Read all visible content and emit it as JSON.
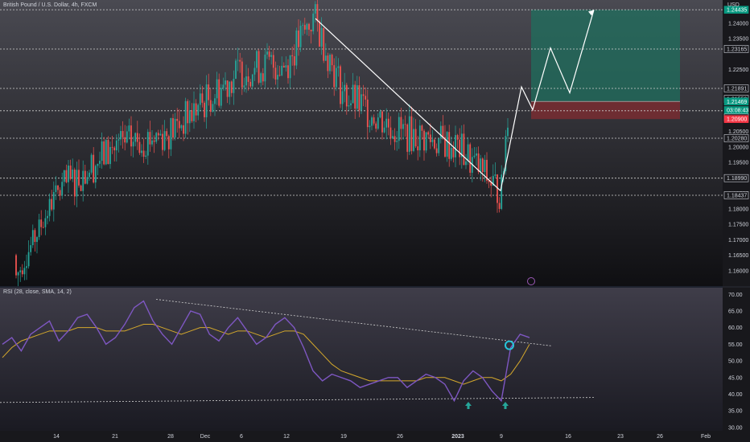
{
  "header": {
    "title": "British Pound / U.S. Dollar, 4h, FXCM",
    "currency": "USD"
  },
  "rsi_header": {
    "title": "RSI (28, close, SMA, 14, 2)"
  },
  "colors": {
    "up": "#26a69a",
    "down": "#ef5350",
    "rsi": "#7e57c2",
    "sma": "#d4a82c",
    "tp_zone": "#1f6f5e",
    "sl_zone": "#7d2c31"
  },
  "chart_data": [
    {
      "type": "candlestick",
      "title": "British Pound / U.S. Dollar, 4h, FXCM",
      "ylim": [
        1.155,
        1.2475
      ],
      "price_ticks": [
        "1.24000",
        "1.23500",
        "1.22500",
        "1.20500",
        "1.20000",
        "1.19500",
        "1.18500",
        "1.18000",
        "1.17500",
        "1.17000",
        "1.16500",
        "1.16000"
      ],
      "x_ticks": [
        "14",
        "21",
        "28",
        "Dec",
        "6",
        "12",
        "19",
        "26",
        "2023",
        "9",
        "16",
        "23",
        "26",
        "Feb"
      ],
      "horizontal_levels": [
        "1.24435",
        "1.23165",
        "1.21891",
        "1.21169",
        "1.20280",
        "1.18990",
        "1.18437"
      ],
      "price_labels": [
        {
          "text": "1.24435",
          "value": 1.24435,
          "style": "green"
        },
        {
          "text": "1.23165",
          "value": 1.23165,
          "style": "outline"
        },
        {
          "text": "1.21891",
          "value": 1.21891,
          "style": "outline"
        },
        {
          "text": "1.21550",
          "value": 1.2155,
          "style": "outline"
        },
        {
          "text": "1.21469",
          "value": 1.21469,
          "style": "green"
        },
        {
          "text": "03:08:43",
          "value": 1.2119,
          "style": "green"
        },
        {
          "text": "1.21117",
          "value": 1.20947,
          "style": "outline"
        },
        {
          "text": "1.20900",
          "value": 1.209,
          "style": "red"
        },
        {
          "text": "1.20280",
          "value": 1.2028,
          "style": "outline"
        },
        {
          "text": "1.18990",
          "value": 1.1899,
          "style": "outline"
        },
        {
          "text": "1.18437",
          "value": 1.18437,
          "style": "outline"
        }
      ],
      "trade_box": {
        "entry": 1.21469,
        "target": 1.24435,
        "stop": 1.209
      },
      "price_path": [
        {
          "label": "Nov 14",
          "close": 1.185
        },
        {
          "label": "Nov 21",
          "close": 1.2
        },
        {
          "label": "Nov 28",
          "close": 1.205
        },
        {
          "label": "Dec 6",
          "close": 1.225
        },
        {
          "label": "Dec 12",
          "close": 1.227
        },
        {
          "label": "Dec 14",
          "close": 1.242
        },
        {
          "label": "Dec 19",
          "close": 1.217
        },
        {
          "label": "Dec 26",
          "close": 1.205
        },
        {
          "label": "Jan 2",
          "close": 1.2
        },
        {
          "label": "Jan 6",
          "close": 1.185
        },
        {
          "label": "Jan 9",
          "close": 1.215
        }
      ]
    },
    {
      "type": "line",
      "title": "RSI (28, close, SMA, 14, 2)",
      "ylim": [
        29,
        72
      ],
      "y_ticks": [
        "70.00",
        "65.00",
        "60.00",
        "55.00",
        "50.00",
        "45.00",
        "40.00",
        "35.00",
        "30.00"
      ],
      "series": [
        {
          "name": "RSI",
          "values": [
            55,
            57,
            53,
            58,
            60,
            62,
            56,
            59,
            63,
            64,
            60,
            55,
            57,
            61,
            66,
            68,
            62,
            58,
            55,
            60,
            65,
            64,
            58,
            56,
            60,
            63,
            59,
            55,
            57,
            61,
            63,
            60,
            54,
            47,
            44,
            46,
            45,
            44,
            42,
            43,
            44,
            45,
            45,
            42,
            44,
            46,
            45,
            43,
            38,
            44,
            47,
            45,
            41,
            38,
            54,
            58,
            57
          ]
        },
        {
          "name": "SMA",
          "values": [
            51,
            54,
            56,
            57,
            58,
            59,
            59,
            59,
            60,
            60,
            60,
            59,
            59,
            59,
            60,
            61,
            61,
            60,
            59,
            58,
            59,
            60,
            60,
            59,
            58,
            59,
            59,
            58,
            57,
            58,
            59,
            59,
            58,
            55,
            52,
            49,
            47,
            46,
            45,
            44,
            44,
            44,
            44,
            44,
            44,
            45,
            45,
            45,
            44,
            43,
            44,
            45,
            45,
            44,
            46,
            50,
            55
          ]
        }
      ]
    }
  ]
}
